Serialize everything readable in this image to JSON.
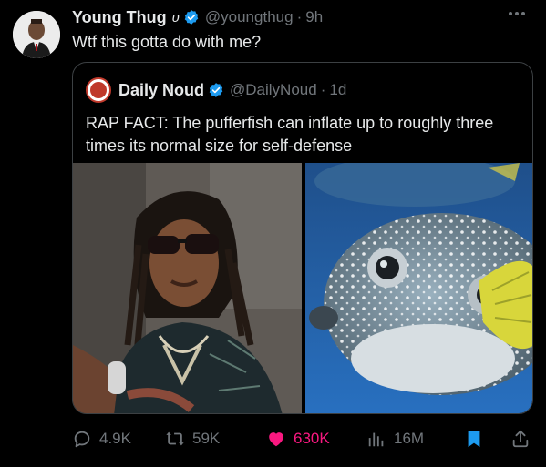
{
  "author": {
    "name": "Young Thug",
    "glyph": "υ",
    "handle": "@youngthug",
    "time": "9h",
    "text": "Wtf this gotta do with me?"
  },
  "quote": {
    "name": "Daily Noud",
    "handle": "@DailyNoud",
    "time": "1d",
    "text": "RAP FACT: The pufferfish can inflate up to roughly three times its normal size for self-defense"
  },
  "actions": {
    "replies": "4.9K",
    "retweets": "59K",
    "likes": "630K",
    "views": "16M"
  },
  "colors": {
    "like": "#f91880",
    "verified": "#1d9bf0",
    "bookmark": "#1d9bf0",
    "muted": "#71767b"
  }
}
